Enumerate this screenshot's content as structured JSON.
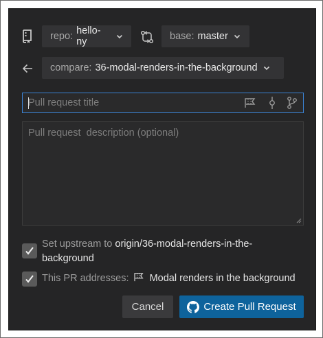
{
  "repo": {
    "label": "repo:",
    "value": "hello-ny"
  },
  "base": {
    "label": "base:",
    "value": "master"
  },
  "compare": {
    "label": "compare:",
    "value": "36-modal-renders-in-the-background"
  },
  "title_input": {
    "placeholder": "Pull request title",
    "value": ""
  },
  "description": {
    "placeholder": "Pull request  description (optional)",
    "value": ""
  },
  "upstream": {
    "checked": true,
    "prefix": "Set upstream to",
    "target_line1": "origin/36-modal-renders-in-the-",
    "target_line2": "background"
  },
  "addresses": {
    "checked": true,
    "prefix": "This PR addresses:",
    "issue": "Modal renders in the background"
  },
  "buttons": {
    "cancel": "Cancel",
    "create": "Create Pull Request"
  },
  "colors": {
    "panel_bg": "#252526",
    "pill_bg": "#333335",
    "focus_border": "#3b84d6",
    "primary_button": "#0e639c",
    "secondary_button": "#3a3a3c"
  },
  "icons": {
    "repo": "repo-icon",
    "compare": "git-compare-icon",
    "back": "arrow-left-icon",
    "milestone": "milestone-icon",
    "commit": "git-commit-icon",
    "branch": "git-branch-icon",
    "github": "github-icon"
  }
}
